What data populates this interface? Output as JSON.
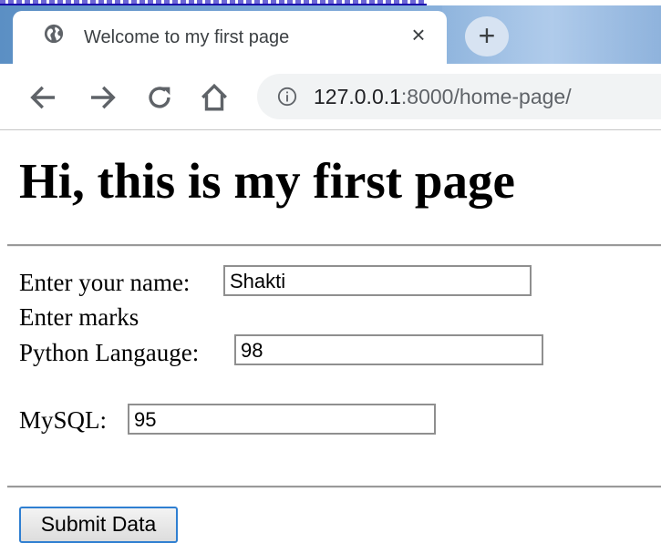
{
  "browser": {
    "tab_title": "Welcome to my first page",
    "new_tab_symbol": "+",
    "close_symbol": "×",
    "url_host": "127.0.0.1",
    "url_rest": ":8000/home-page/",
    "icons": [
      "globe-icon",
      "close-icon",
      "new-tab-icon",
      "back-arrow-icon",
      "forward-arrow-icon",
      "reload-icon",
      "home-icon",
      "info-icon"
    ]
  },
  "page": {
    "heading": "Hi, this is my first page",
    "name_label": "Enter your name:",
    "name_value": "Shakti",
    "marks_label": "Enter marks",
    "python_label": "Python Langauge:",
    "python_value": "98",
    "mysql_label": "MySQL:",
    "mysql_value": "95",
    "submit_label": "Submit Data"
  }
}
